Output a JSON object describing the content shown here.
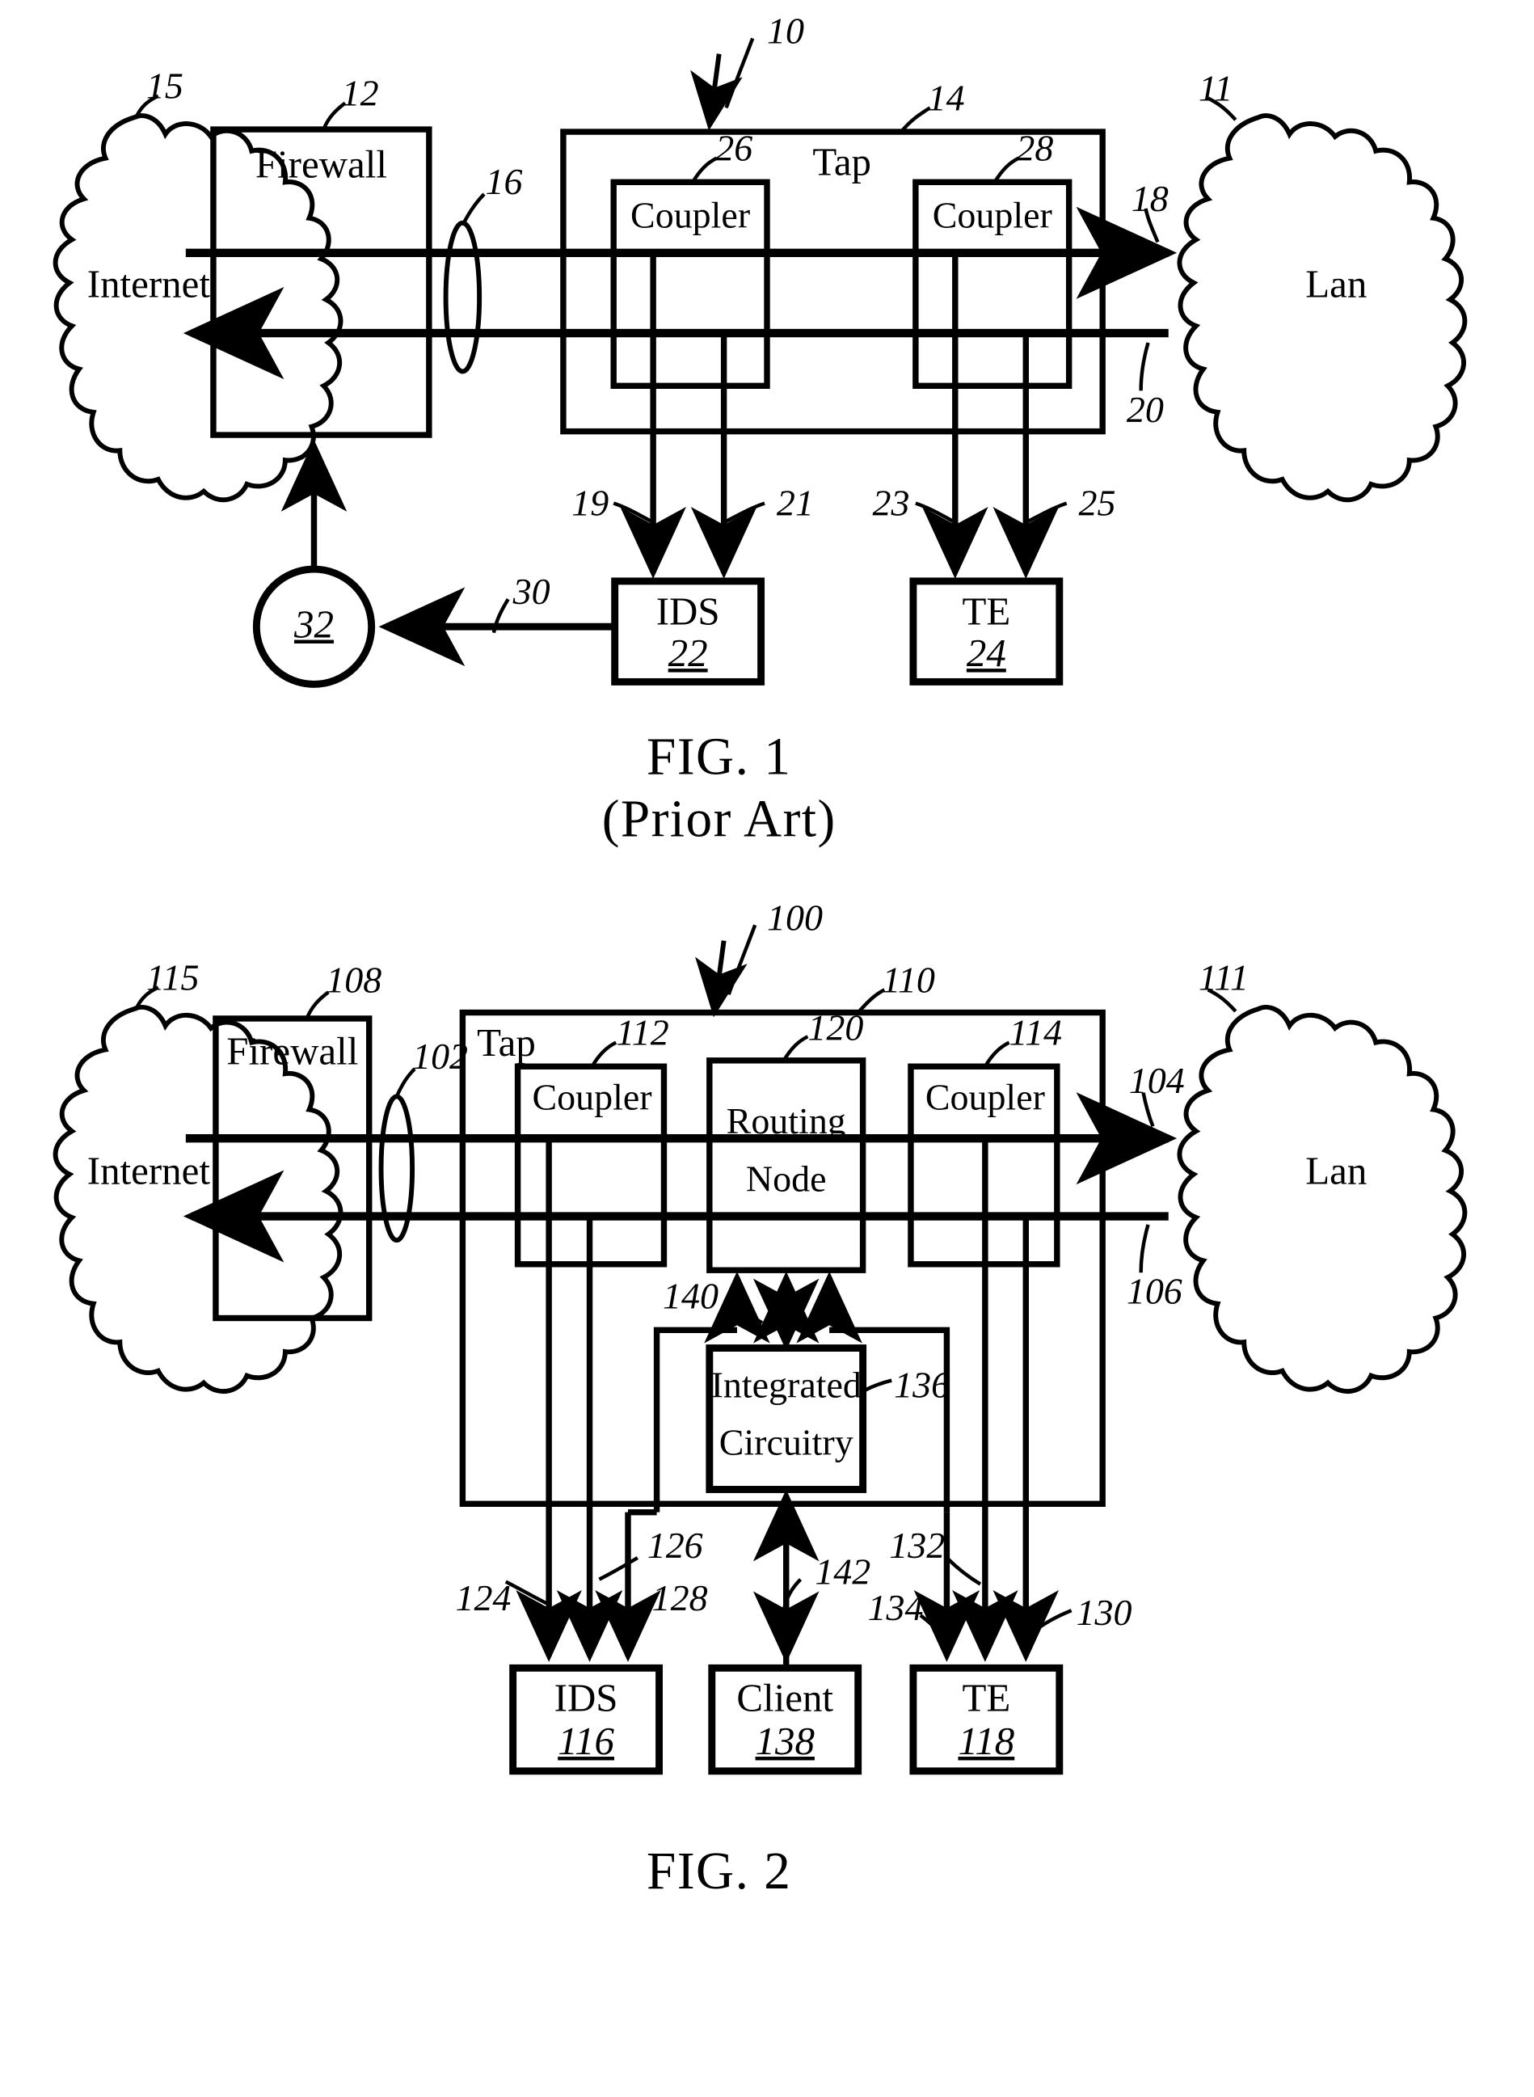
{
  "document": {
    "type": "patent-drawing-sheet",
    "figures": [
      {
        "id": "fig1",
        "caption_line1": "FIG.  1",
        "caption_line2": "(Prior Art)",
        "system_ref": "10",
        "nodes": {
          "internet": {
            "label": "Internet",
            "ref": "15"
          },
          "firewall": {
            "label": "Firewall",
            "ref": "12"
          },
          "tap": {
            "label": "Tap",
            "ref": "14"
          },
          "coupler_left": {
            "label": "Coupler",
            "ref": "26"
          },
          "coupler_right": {
            "label": "Coupler",
            "ref": "28"
          },
          "lan": {
            "label": "Lan",
            "ref": "11"
          },
          "ids": {
            "label": "IDS",
            "ref": "22"
          },
          "te": {
            "label": "TE",
            "ref": "24"
          },
          "console": {
            "ref": "32"
          }
        },
        "link_refs": {
          "fiber_pair": "16",
          "lan_out": "18",
          "lan_in": "20",
          "ids_tap_a": "19",
          "ids_tap_b": "21",
          "te_tap_a": "23",
          "te_tap_b": "25",
          "alert_link": "30"
        }
      },
      {
        "id": "fig2",
        "caption_line1": "FIG.  2",
        "caption_line2": "",
        "system_ref": "100",
        "nodes": {
          "internet": {
            "label": "Internet",
            "ref": "115"
          },
          "firewall": {
            "label": "Firewall",
            "ref": "108"
          },
          "tap": {
            "label": "Tap",
            "ref": "110"
          },
          "coupler_left": {
            "label": "Coupler",
            "ref": "112"
          },
          "routing_node": {
            "label_line1": "Routing",
            "label_line2": "Node",
            "ref": "120"
          },
          "coupler_right": {
            "label": "Coupler",
            "ref": "114"
          },
          "integrated_circuitry": {
            "label_line1": "Integrated",
            "label_line2": "Circuitry",
            "ref": "136"
          },
          "lan": {
            "label": "Lan",
            "ref": "111"
          },
          "ids": {
            "label": "IDS",
            "ref": "116"
          },
          "client": {
            "label": "Client",
            "ref": "138"
          },
          "te": {
            "label": "TE",
            "ref": "118"
          }
        },
        "link_refs": {
          "fiber_pair": "102",
          "lan_out": "104",
          "lan_in": "106",
          "ids_a": "124",
          "ids_b": "126",
          "ids_c": "128",
          "te_a": "130",
          "te_b": "132",
          "te_c": "134",
          "routing_bus": "140",
          "client_link": "142"
        }
      }
    ]
  }
}
